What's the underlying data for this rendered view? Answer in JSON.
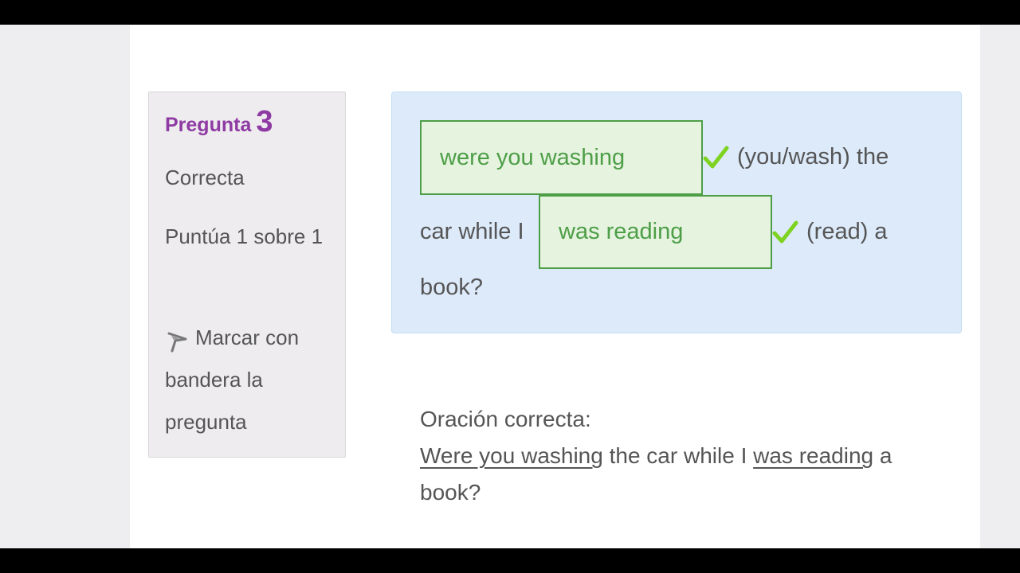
{
  "question": {
    "label": "Pregunta",
    "number": "3",
    "status": "Correcta",
    "grade": "Puntúa 1 sobre 1",
    "flag_label": "Marcar con bandera la pregunta",
    "flag_icon": "flag-icon"
  },
  "exercise": {
    "answer1": "were you washing",
    "hint1": "(you/wash) the",
    "text2": "car while I",
    "answer2": "was reading",
    "hint2": "(read) a",
    "text3": "book?",
    "check_icon": "check-icon",
    "check_color": "#7ed321"
  },
  "correct_sentence": {
    "heading": "Oración correcta:",
    "part1": "Were you washing",
    "part2": " the car while I ",
    "part3": "was reading",
    "part4": " a book?"
  },
  "colors": {
    "question_accent": "#8e3ba3",
    "answer_green": "#4e9e47",
    "answer_bg": "#e5f3df",
    "question_bg": "#ddeafa"
  }
}
